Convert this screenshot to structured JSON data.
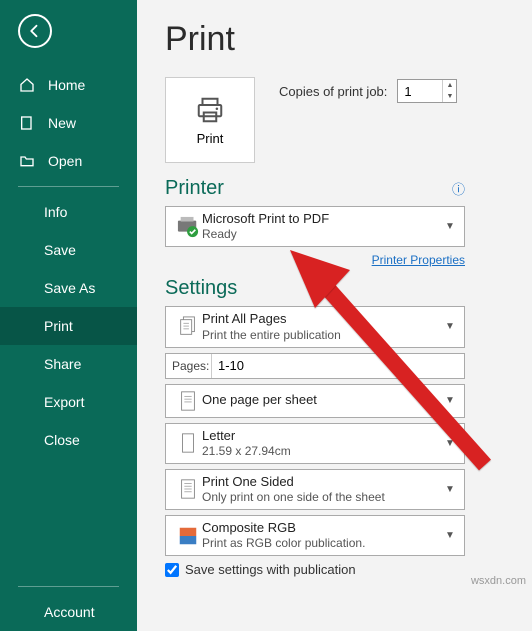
{
  "sidebar": {
    "home": "Home",
    "new": "New",
    "open": "Open",
    "info": "Info",
    "save": "Save",
    "saveas": "Save As",
    "print": "Print",
    "share": "Share",
    "export": "Export",
    "close": "Close",
    "account": "Account"
  },
  "page_title": "Print",
  "copies": {
    "label": "Copies of print job:",
    "value": "1"
  },
  "print_button_label": "Print",
  "printer": {
    "section": "Printer",
    "name": "Microsoft Print to PDF",
    "status": "Ready",
    "properties": "Printer Properties"
  },
  "settings": {
    "section": "Settings",
    "pages_label": "Pages:",
    "pages_value": "1-10",
    "print_all": {
      "line1": "Print All Pages",
      "line2": "Print the entire publication"
    },
    "pps": {
      "line1": "One page per sheet"
    },
    "paper": {
      "line1": "Letter",
      "line2": "21.59 x 27.94cm"
    },
    "sided": {
      "line1": "Print One Sided",
      "line2": "Only print on one side of the sheet"
    },
    "color": {
      "line1": "Composite RGB",
      "line2": "Print as RGB color publication."
    },
    "save_with_pub": "Save settings with publication"
  },
  "watermark": "wsxdn.com"
}
